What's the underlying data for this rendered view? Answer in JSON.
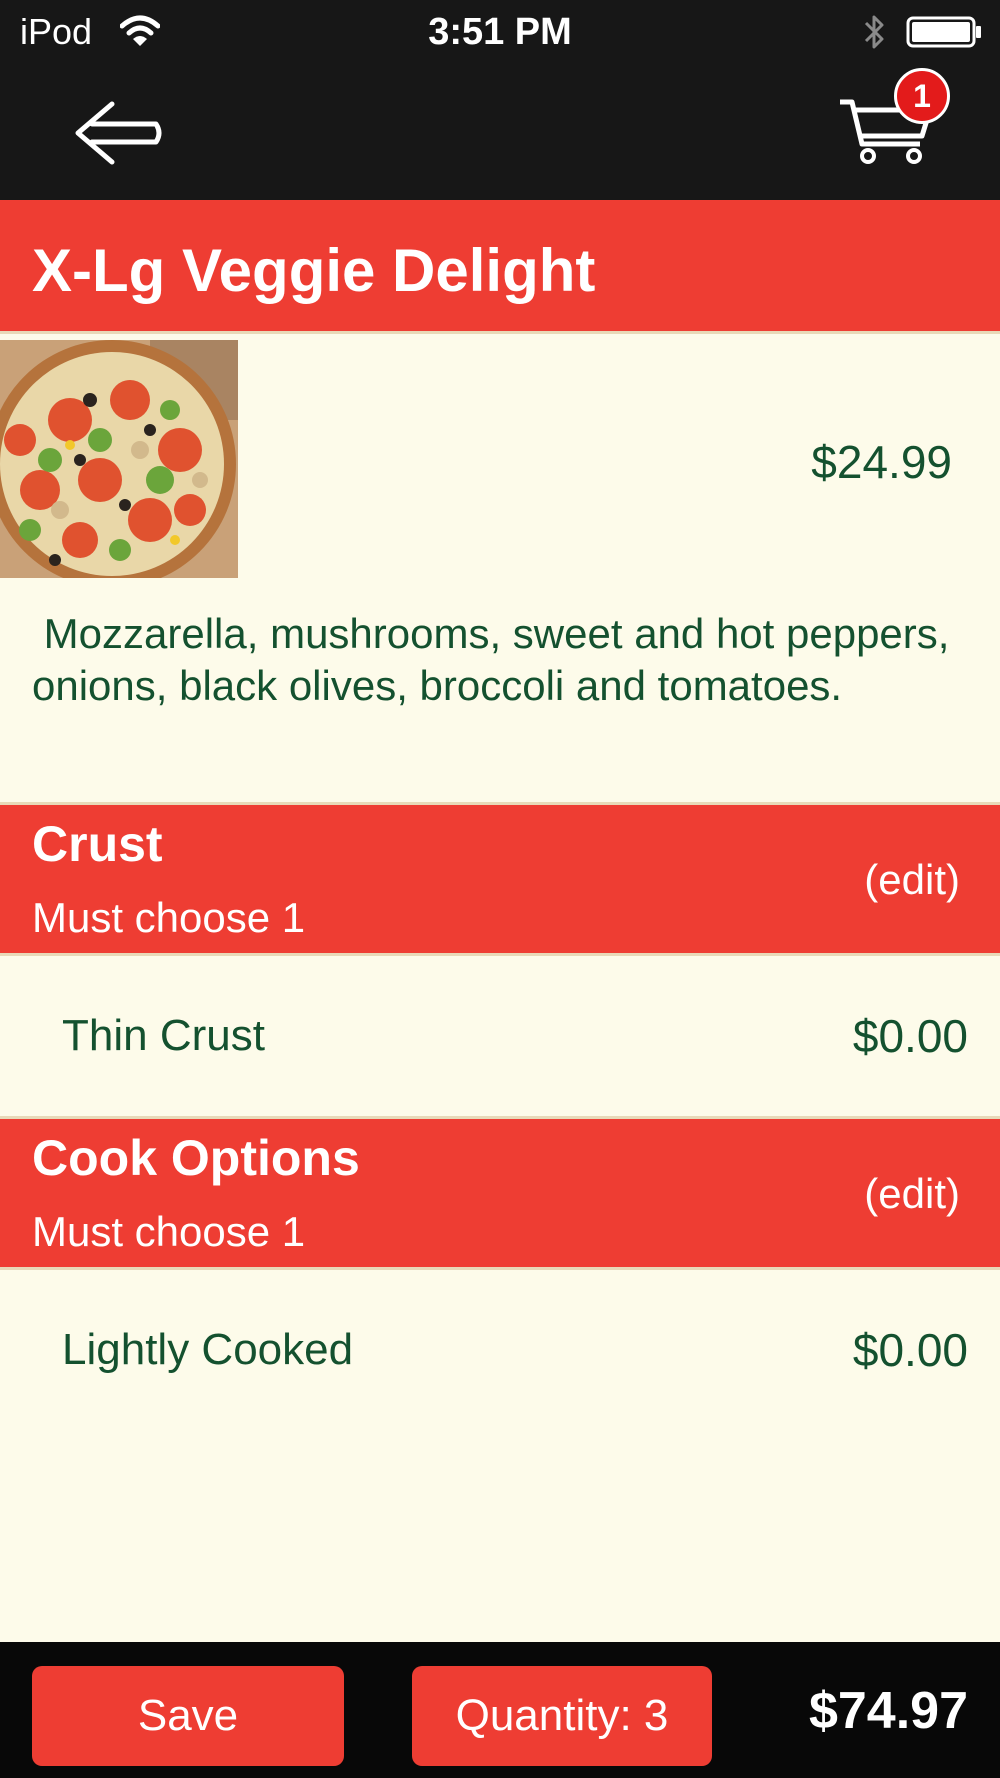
{
  "status_bar": {
    "carrier": "iPod",
    "time": "3:51 PM",
    "icons": [
      "wifi-icon",
      "bluetooth-icon",
      "battery-icon"
    ]
  },
  "nav": {
    "back_icon": "arrow-left-icon",
    "cart_icon": "shopping-cart-icon",
    "cart_count": "1"
  },
  "product": {
    "title": "X-Lg Veggie Delight",
    "price": "$24.99",
    "description": " Mozzarella, mushrooms, sweet and hot peppers, onions, black olives, broccoli and tomatoes."
  },
  "sections": [
    {
      "title": "Crust",
      "subtitle": "Must choose 1",
      "edit_label": "(edit)",
      "option": {
        "name": "Thin Crust",
        "price": "$0.00"
      }
    },
    {
      "title": "Cook Options",
      "subtitle": "Must choose 1",
      "edit_label": "(edit)",
      "option": {
        "name": "Lightly Cooked",
        "price": "$0.00"
      }
    }
  ],
  "footer": {
    "save_label": "Save",
    "quantity_label": "Quantity: 3",
    "total": "$74.97"
  },
  "colors": {
    "accent_red": "#EE3D33",
    "text_green": "#14512F",
    "background": "#FDFBEA",
    "bar_dark": "#171717",
    "badge_red": "#E31B1B"
  }
}
